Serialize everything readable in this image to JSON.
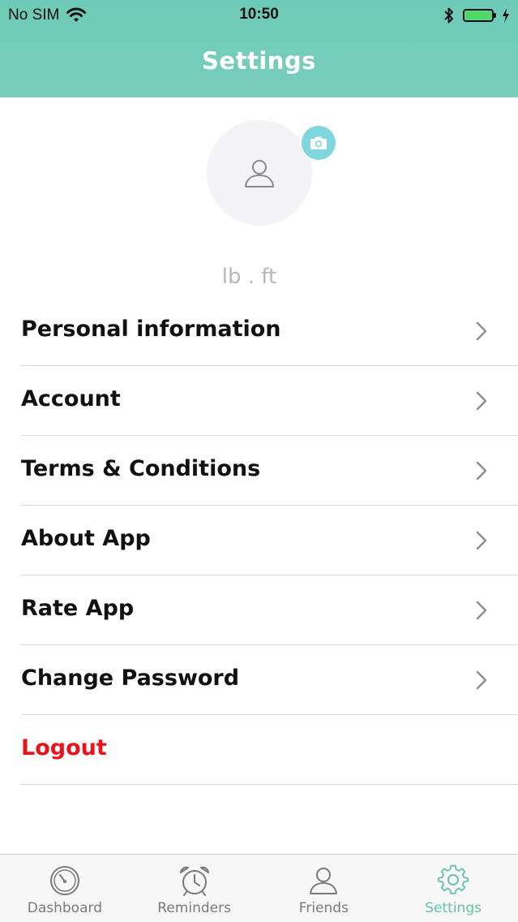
{
  "status_bar": {
    "carrier": "No SIM",
    "time": "10:50",
    "battery_color": "#4cd964"
  },
  "header": {
    "title": "Settings",
    "color": "#74ccba"
  },
  "profile": {
    "avatar_icon": "user-icon",
    "camera_icon": "camera-icon",
    "units": "lb . ft"
  },
  "menu": {
    "items": [
      {
        "label": "Personal information"
      },
      {
        "label": "Account"
      },
      {
        "label": "Terms & Conditions"
      },
      {
        "label": "About App"
      },
      {
        "label": "Rate App"
      },
      {
        "label": "Change Password"
      }
    ],
    "logout_label": "Logout",
    "logout_color": "#e8141b"
  },
  "tabbar": {
    "tabs": [
      {
        "label": "Dashboard",
        "icon": "speedometer-icon"
      },
      {
        "label": "Reminders",
        "icon": "alarm-clock-icon"
      },
      {
        "label": "Friends",
        "icon": "person-icon"
      },
      {
        "label": "Settings",
        "icon": "gear-icon"
      }
    ],
    "active_index": 3,
    "active_color": "#64c3ad"
  }
}
